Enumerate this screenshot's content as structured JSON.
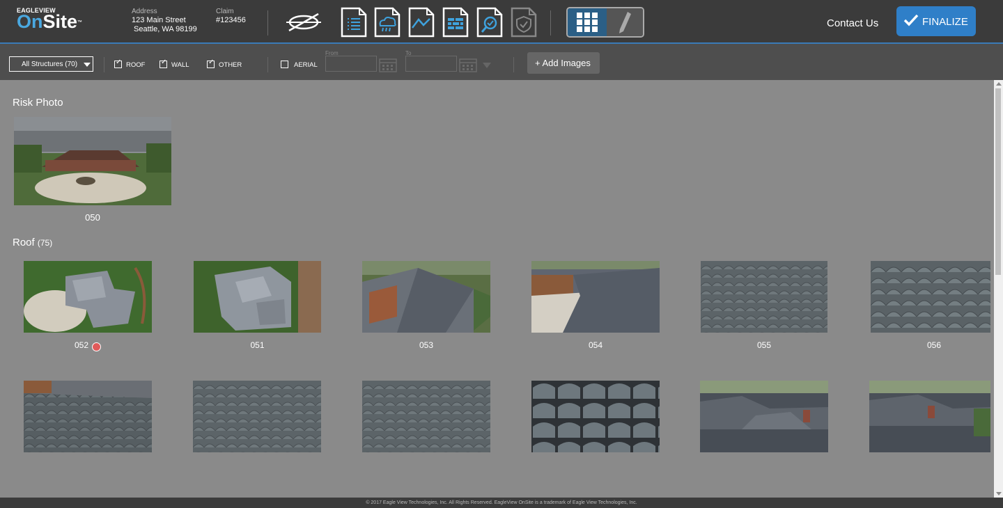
{
  "header": {
    "logo_top": "EAGLEVIEW",
    "logo_on": "On",
    "logo_site": "Site",
    "logo_tm": "™",
    "address_label": "Address",
    "address_line1": "123 Main Street",
    "address_line2": "Seattle, WA 98199",
    "claim_label": "Claim",
    "claim_value": "#123456",
    "contact_label": "Contact Us",
    "finalize_label": "FINALIZE",
    "accent_color": "#2f7fc8"
  },
  "toolbar": {
    "structures_select": "All Structures (70)",
    "roof_label": "ROOF",
    "wall_label": "WALL",
    "other_label": "OTHER",
    "aerial_label": "AERIAL",
    "roof_checked": true,
    "wall_checked": true,
    "other_checked": true,
    "aerial_checked": false,
    "from_label": "From",
    "to_label": "To",
    "add_images_label": "+ Add Images"
  },
  "risk": {
    "title": "Risk Photo",
    "photo_caption": "050"
  },
  "roof": {
    "title": "Roof",
    "count": "(75)",
    "photos": [
      "052",
      "051",
      "053",
      "054",
      "055",
      "056",
      "",
      "",
      "",
      "",
      "",
      ""
    ]
  },
  "footer": {
    "text": "© 2017 Eagle View Technologies, Inc. All Rights Reserved. EagleView OnSite is a trademark of Eagle View Technologies, Inc."
  }
}
